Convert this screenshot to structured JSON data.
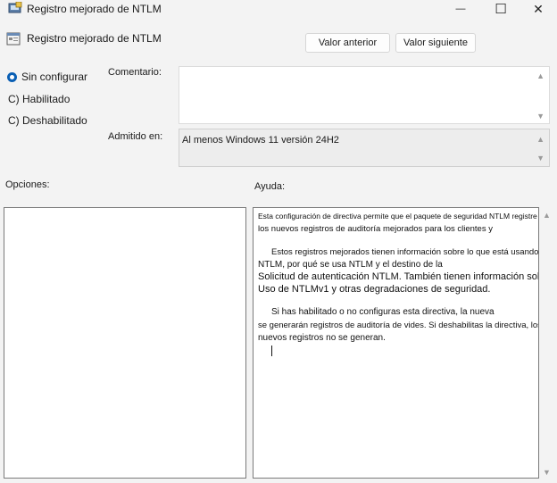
{
  "window": {
    "title": "Registro mejorado de NTLM",
    "minimize_glyph": "—",
    "maximize_glyph": "☐",
    "close_glyph": "✕"
  },
  "header": {
    "title": "Registro mejorado de NTLM",
    "prev_label": "Valor anterior",
    "next_label": "Valor siguiente"
  },
  "state": {
    "options": [
      {
        "label": "Sin configurar",
        "selected": true
      },
      {
        "label": "C) Habilitado",
        "selected": false
      },
      {
        "label": "C) Deshabilitado",
        "selected": false
      }
    ]
  },
  "comment": {
    "label": "Comentario:",
    "value": ""
  },
  "supported": {
    "label": "Admitido en:",
    "value": "Al menos Windows 11 versión 24H2"
  },
  "options_pane": {
    "label": "Opciones:"
  },
  "help_pane": {
    "label": "Ayuda:",
    "lines": [
      "Esta configuración de directiva permite que el paquete de seguridad NTLM registre",
      "los nuevos registros de auditoría mejorados para los clientes y",
      "Estos registros mejorados tienen información sobre lo que está usando",
      "NTLM, por qué se usa NTLM y el destino de la",
      "Solicitud de autenticación NTLM. También tienen información sobre",
      "Uso de NTLMv1 y otras degradaciones de seguridad.",
      "Si has habilitado o no configuras esta directiva, la nueva",
      "se generarán registros de auditoría de vides. Si deshabilitas la directiva, los",
      "nuevos registros no se generan."
    ]
  },
  "colors": {
    "accent": "#0a5fb4",
    "background": "#f3f3f3"
  }
}
